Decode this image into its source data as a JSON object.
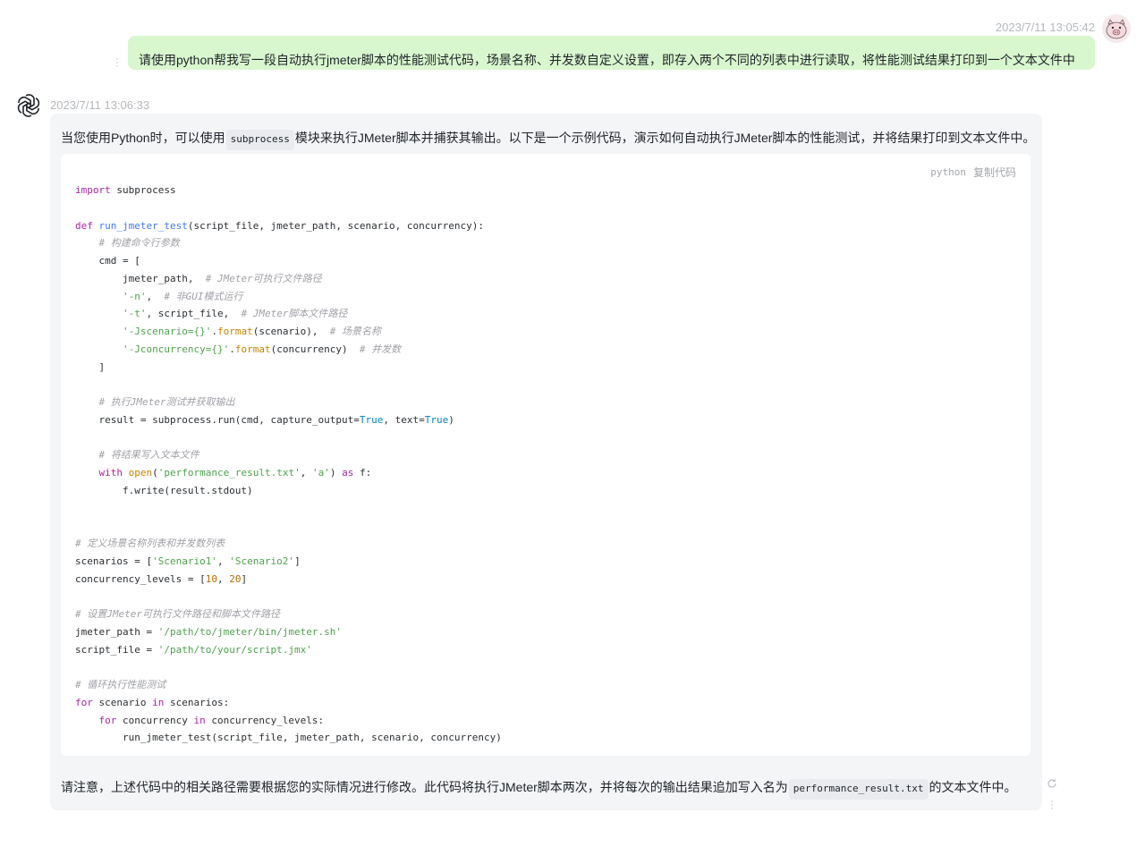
{
  "user_message": {
    "time": "2023/7/11 13:05:42",
    "text": "请使用python帮我写一段自动执行jmeter脚本的性能测试代码，场景名称、并发数自定义设置，即存入两个不同的列表中进行读取，将性能测试结果打印到一个文本文件中",
    "avatar_icon": "pig-avatar-icon"
  },
  "bot_message": {
    "time": "2023/7/11 13:06:33",
    "avatar_icon": "openai-logo-icon",
    "intro_before": "当您使用Python时，可以使用",
    "intro_code": "subprocess",
    "intro_after": "模块来执行JMeter脚本并捕获其输出。以下是一个示例代码，演示如何自动执行JMeter脚本的性能测试，并将结果打印到文本文件中。",
    "code_block": {
      "language": "python",
      "copy_label": "复制代码",
      "lines": [
        "import subprocess",
        "",
        "def run_jmeter_test(script_file, jmeter_path, scenario, concurrency):",
        "    # 构建命令行参数",
        "    cmd = [",
        "        jmeter_path,  # JMeter可执行文件路径",
        "        '-n',  # 非GUI模式运行",
        "        '-t', script_file,  # JMeter脚本文件路径",
        "        '-Jscenario={}'.format(scenario),  # 场景名称",
        "        '-Jconcurrency={}'.format(concurrency)  # 并发数",
        "    ]",
        "",
        "    # 执行JMeter测试并获取输出",
        "    result = subprocess.run(cmd, capture_output=True, text=True)",
        "",
        "    # 将结果写入文本文件",
        "    with open('performance_result.txt', 'a') as f:",
        "        f.write(result.stdout)",
        "",
        "",
        "# 定义场景名称列表和并发数列表",
        "scenarios = ['Scenario1', 'Scenario2']",
        "concurrency_levels = [10, 20]",
        "",
        "# 设置JMeter可执行文件路径和脚本文件路径",
        "jmeter_path = '/path/to/jmeter/bin/jmeter.sh'",
        "script_file = '/path/to/your/script.jmx'",
        "",
        "# 循环执行性能测试",
        "for scenario in scenarios:",
        "    for concurrency in concurrency_levels:",
        "        run_jmeter_test(script_file, jmeter_path, scenario, concurrency)"
      ]
    },
    "outro_before": "请注意，上述代码中的相关路径需要根据您的实际情况进行修改。此代码将执行JMeter脚本两次，并将每次的输出结果追加写入名为",
    "outro_code": "performance_result.txt",
    "outro_after": "的文本文件中。",
    "refresh_icon": "refresh-icon",
    "more_icon": "more-vertical-icon"
  },
  "colors": {
    "user_bubble": "#d9f7cf",
    "bot_bubble": "#f4f5f7",
    "code_bg": "#ffffff",
    "timestamp": "#b5b8bd"
  }
}
